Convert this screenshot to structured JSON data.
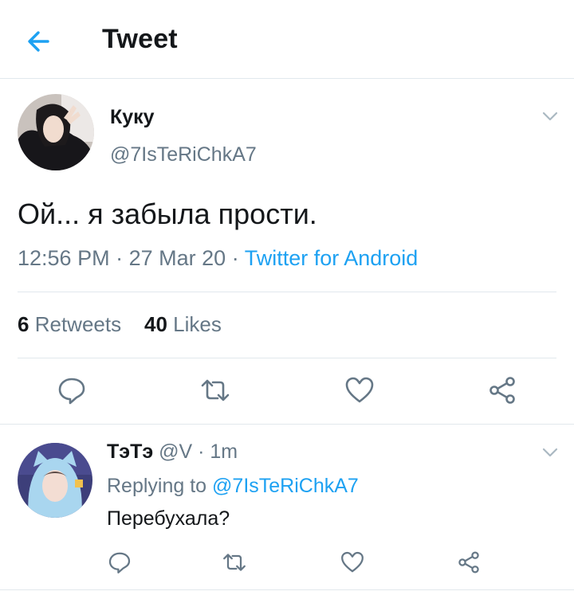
{
  "header": {
    "title": "Tweet",
    "back_icon": "arrow-left-icon"
  },
  "colors": {
    "accent": "#1da1f2",
    "secondary_text": "#657786",
    "primary_text": "#14171a",
    "divider": "#e1e8ed"
  },
  "tweet": {
    "display_name": "Куку",
    "handle": "@7IsTeRiChkA7",
    "text": "Ой... я забыла прости.",
    "time": "12:56 PM",
    "date": "27 Mar 20",
    "separator": "·",
    "source": "Twitter for Android",
    "retweets_count": "6",
    "retweets_label": "Retweets",
    "likes_count": "40",
    "likes_label": "Likes",
    "actions": [
      "reply-icon",
      "retweet-icon",
      "like-icon",
      "share-icon"
    ]
  },
  "reply": {
    "display_name": "ТэТэ",
    "handle": "@V",
    "separator": "·",
    "time_ago": "1m",
    "replying_prefix": "Replying to",
    "replying_to": "@7IsTeRiChkA7",
    "text": "Перебухала?",
    "actions": [
      "reply-icon",
      "retweet-icon",
      "like-icon",
      "share-icon"
    ]
  }
}
